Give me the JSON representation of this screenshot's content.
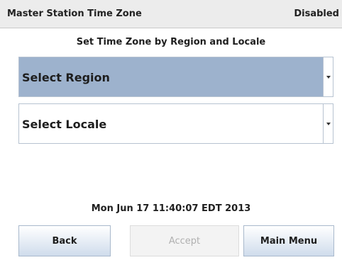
{
  "header": {
    "title": "Master Station Time Zone",
    "status": "Disabled"
  },
  "main": {
    "subtitle": "Set Time Zone by Region and Locale",
    "region_select": {
      "label": "Select Region"
    },
    "locale_select": {
      "label": "Select Locale"
    },
    "datetime": "Mon Jun 17 11:40:07 EDT 2013"
  },
  "buttons": {
    "back": "Back",
    "accept": "Accept",
    "main_menu": "Main Menu"
  },
  "colors": {
    "selected_dropdown": "#9db2cd",
    "button_gradient_end": "#cfdcec",
    "disabled_text": "#b0b0b0"
  },
  "icons": {
    "dropdown_arrow": "chevron-down-icon"
  }
}
